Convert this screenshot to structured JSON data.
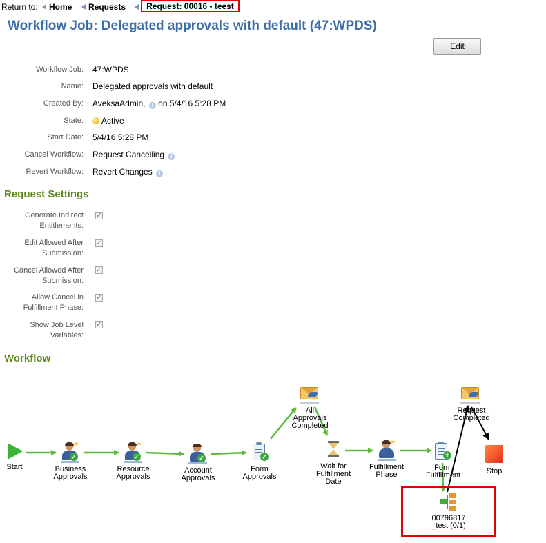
{
  "breadcrumb": {
    "return_label": "Return to:",
    "home": "Home",
    "requests": "Requests",
    "current": "Request: 00016 - teest"
  },
  "page_title": "Workflow Job: Delegated approvals with default (47:WPDS)",
  "edit_label": "Edit",
  "details": {
    "workflow_job_label": "Workflow Job:",
    "workflow_job": "47:WPDS",
    "name_label": "Name:",
    "name": "Delegated approvals with default",
    "created_by_label": "Created By:",
    "created_by_user": "AveksaAdmin,",
    "created_by_date": "on 5/4/16 5:28 PM",
    "state_label": "State:",
    "state": "Active",
    "start_date_label": "Start Date:",
    "start_date": "5/4/16 5:28 PM",
    "cancel_workflow_label": "Cancel Workflow:",
    "cancel_workflow": "Request Cancelling",
    "revert_workflow_label": "Revert Workflow:",
    "revert_workflow": "Revert Changes"
  },
  "request_settings": {
    "title": "Request Settings",
    "items": [
      {
        "label": "Generate Indirect\nEntitlements:",
        "checked": true
      },
      {
        "label": "Edit Allowed After\nSubmission:",
        "checked": true
      },
      {
        "label": "Cancel Allowed After\nSubmission:",
        "checked": true
      },
      {
        "label": "Allow Cancel in\nFulfillment Phase:",
        "checked": true
      },
      {
        "label": "Show Job Level\nVariables:",
        "checked": true
      }
    ]
  },
  "workflow": {
    "title": "Workflow",
    "nodes": {
      "start": "Start",
      "business": "Business\nApprovals",
      "resource": "Resource\nApprovals",
      "account": "Account\nApprovals",
      "form_approvals": "Form\nApprovals",
      "all_approvals": "All\nApprovals\nCompleted",
      "wait": "Wait for\nFulfillment\nDate",
      "fulfillment_phase": "Fulfillment\nPhase",
      "form_fulfillment": "Form\nFulfillment",
      "request_completed": "Request\nCompleted",
      "stop": "Stop",
      "subprocess": "00796817\n_test (0/1)"
    },
    "colors": {
      "transition": "#5dbb3a",
      "active_arrow": "#000000",
      "highlight": "#e00000"
    }
  }
}
